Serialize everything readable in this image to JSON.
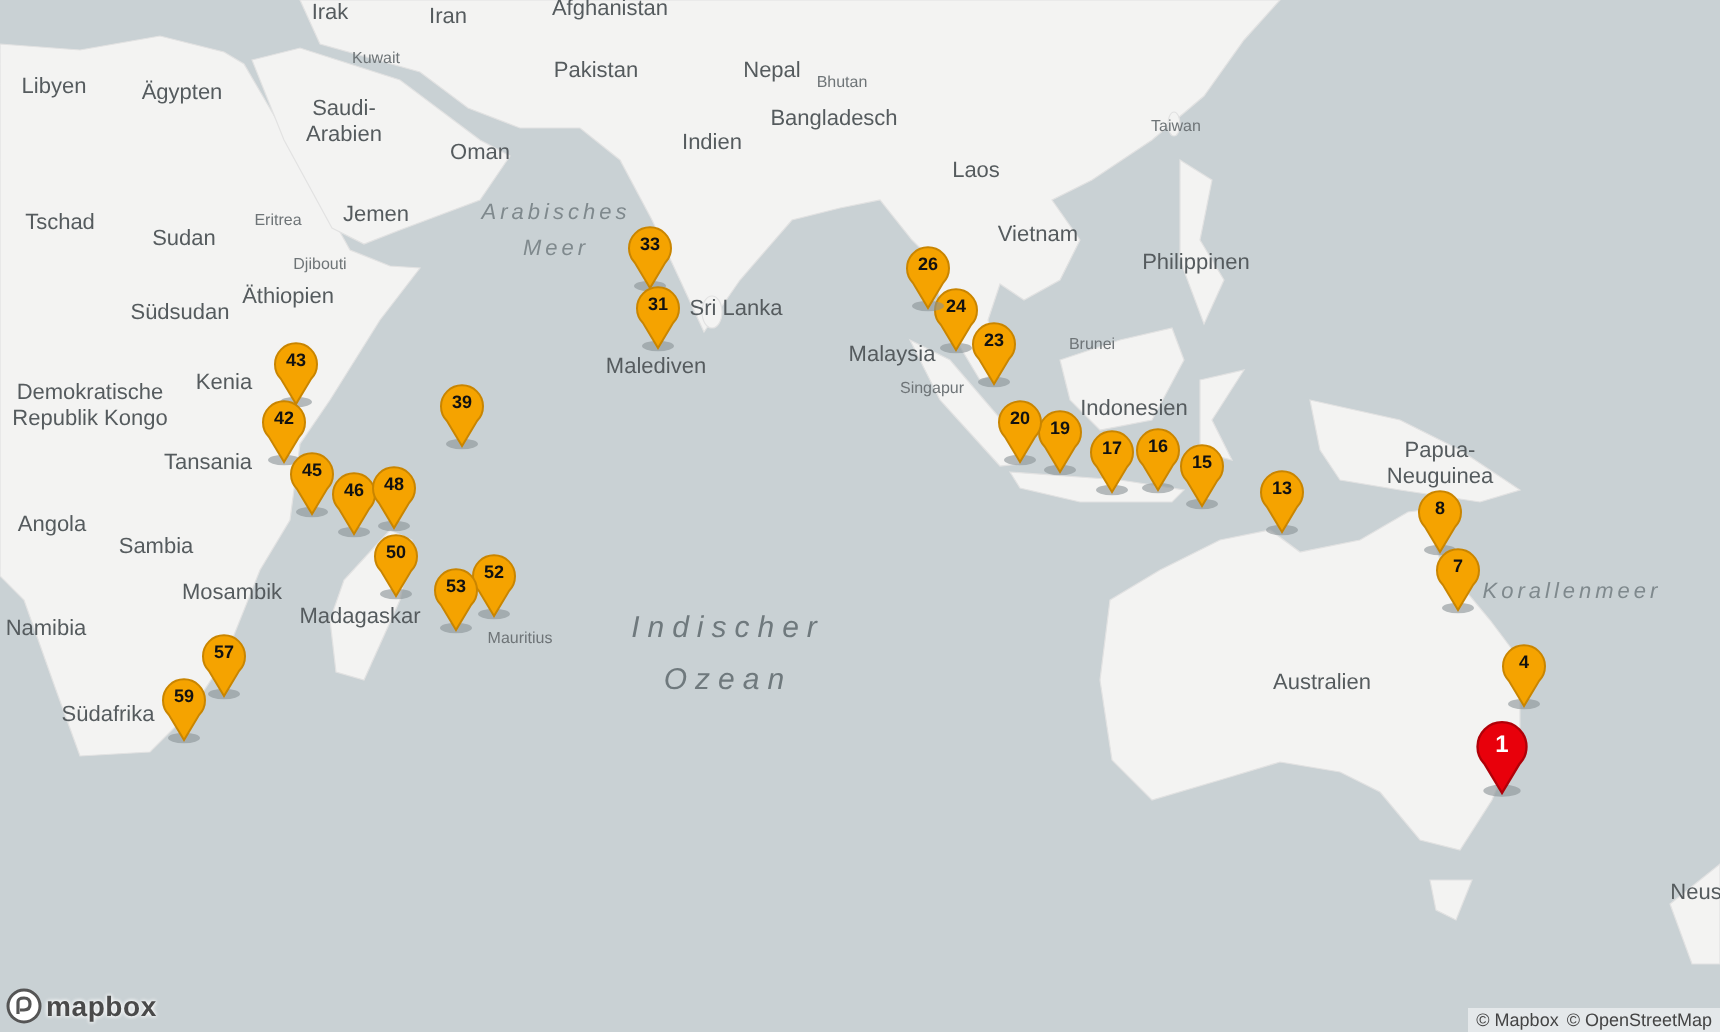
{
  "map": {
    "place_labels": [
      {
        "text": "Irak",
        "kind": "country"
      },
      {
        "text": "Iran",
        "kind": "country"
      },
      {
        "text": "Afghanistan",
        "kind": "country"
      },
      {
        "text": "Libyen",
        "kind": "country"
      },
      {
        "text": "Ägypten",
        "kind": "country"
      },
      {
        "text": "Kuwait",
        "kind": "small"
      },
      {
        "text": "Pakistan",
        "kind": "country"
      },
      {
        "text": "Nepal",
        "kind": "country"
      },
      {
        "text": "Bhutan",
        "kind": "small"
      },
      {
        "text": "Saudi-Arabien",
        "kind": "country"
      },
      {
        "text": "Bangladesch",
        "kind": "country"
      },
      {
        "text": "Taiwan",
        "kind": "small"
      },
      {
        "text": "Oman",
        "kind": "country"
      },
      {
        "text": "Indien",
        "kind": "country"
      },
      {
        "text": "Laos",
        "kind": "country"
      },
      {
        "text": "Tschad",
        "kind": "country"
      },
      {
        "text": "Sudan",
        "kind": "country"
      },
      {
        "text": "Eritrea",
        "kind": "small"
      },
      {
        "text": "Jemen",
        "kind": "country"
      },
      {
        "text": "Arabisches Meer",
        "kind": "sea"
      },
      {
        "text": "Djibouti",
        "kind": "small"
      },
      {
        "text": "Vietnam",
        "kind": "country"
      },
      {
        "text": "Philippinen",
        "kind": "country"
      },
      {
        "text": "Äthiopien",
        "kind": "country"
      },
      {
        "text": "Südsudan",
        "kind": "country"
      },
      {
        "text": "Sri Lanka",
        "kind": "country"
      },
      {
        "text": "Demokratische Republik Kongo",
        "kind": "country"
      },
      {
        "text": "Kenia",
        "kind": "country"
      },
      {
        "text": "Malediven",
        "kind": "country"
      },
      {
        "text": "Brunei",
        "kind": "small"
      },
      {
        "text": "Malaysia",
        "kind": "country"
      },
      {
        "text": "Singapur",
        "kind": "small"
      },
      {
        "text": "Tansania",
        "kind": "country"
      },
      {
        "text": "Indonesien",
        "kind": "country"
      },
      {
        "text": "Papua-Neuguinea",
        "kind": "country"
      },
      {
        "text": "Angola",
        "kind": "country"
      },
      {
        "text": "Sambia",
        "kind": "country"
      },
      {
        "text": "Mosambik",
        "kind": "country"
      },
      {
        "text": "Madagaskar",
        "kind": "country"
      },
      {
        "text": "Mauritius",
        "kind": "small"
      },
      {
        "text": "Namibia",
        "kind": "country"
      },
      {
        "text": "Südafrika",
        "kind": "country"
      },
      {
        "text": "Indischer Ozean",
        "kind": "ocean"
      },
      {
        "text": "Korallenmeer",
        "kind": "sea"
      },
      {
        "text": "Australien",
        "kind": "country"
      },
      {
        "text": "Neus",
        "kind": "country"
      }
    ],
    "markers": [
      {
        "label": "1",
        "color": "#e8000b"
      },
      {
        "label": "4",
        "color": "#f5a300"
      },
      {
        "label": "8",
        "color": "#f5a300"
      },
      {
        "label": "7",
        "color": "#f5a300"
      },
      {
        "label": "13",
        "color": "#f5a300"
      },
      {
        "label": "15",
        "color": "#f5a300"
      },
      {
        "label": "16",
        "color": "#f5a300"
      },
      {
        "label": "17",
        "color": "#f5a300"
      },
      {
        "label": "19",
        "color": "#f5a300"
      },
      {
        "label": "20",
        "color": "#f5a300"
      },
      {
        "label": "24",
        "color": "#f5a300"
      },
      {
        "label": "23",
        "color": "#f5a300"
      },
      {
        "label": "26",
        "color": "#f5a300"
      },
      {
        "label": "33",
        "color": "#f5a300"
      },
      {
        "label": "31",
        "color": "#f5a300"
      },
      {
        "label": "39",
        "color": "#f5a300"
      },
      {
        "label": "43",
        "color": "#f5a300"
      },
      {
        "label": "42",
        "color": "#f5a300"
      },
      {
        "label": "45",
        "color": "#f5a300"
      },
      {
        "label": "46",
        "color": "#f5a300"
      },
      {
        "label": "48",
        "color": "#f5a300"
      },
      {
        "label": "50",
        "color": "#f5a300"
      },
      {
        "label": "52",
        "color": "#f5a300"
      },
      {
        "label": "53",
        "color": "#f5a300"
      },
      {
        "label": "57",
        "color": "#f5a300"
      },
      {
        "label": "59",
        "color": "#f5a300"
      }
    ]
  },
  "logo": {
    "text": "mapbox"
  },
  "attribution": [
    {
      "text": "© Mapbox"
    },
    {
      "text": "© OpenStreetMap"
    }
  ]
}
